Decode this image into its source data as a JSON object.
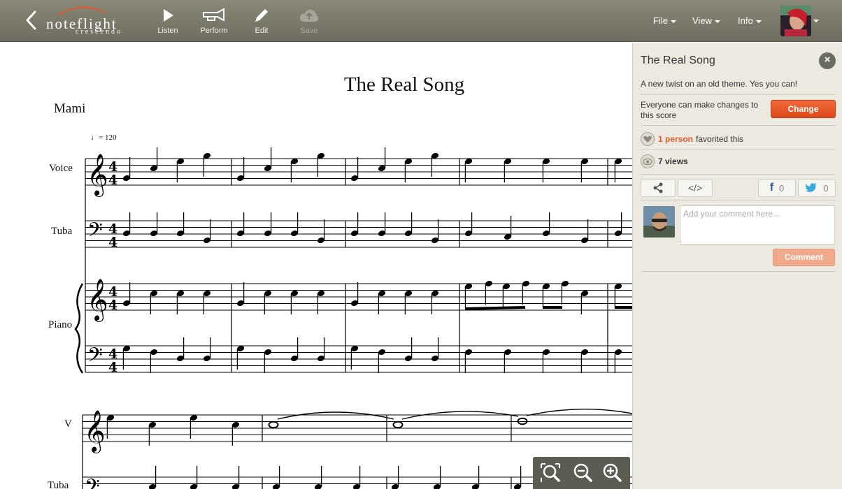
{
  "toolbar": {
    "logo_main": "noteflight",
    "logo_sub": "crescendo",
    "tools": [
      {
        "label": "Listen",
        "icon": "play-icon"
      },
      {
        "label": "Perform",
        "icon": "horn-icon"
      },
      {
        "label": "Edit",
        "icon": "pencil-icon"
      },
      {
        "label": "Save",
        "icon": "cloud-upload-icon",
        "disabled": true
      }
    ],
    "menus": [
      "File",
      "View",
      "Info"
    ]
  },
  "score": {
    "title": "The Real Song",
    "composer": "Mami",
    "tempo": "= 120",
    "system1_instruments": [
      "Voice",
      "Tuba",
      "Piano"
    ],
    "system2_instruments": [
      "V",
      "Tuba"
    ],
    "time_signature": "4/4"
  },
  "panel": {
    "title": "The Real Song",
    "description": "A new twist on an old theme. Yes you can!",
    "permission_text": "Everyone can make changes to this score",
    "change_label": "Change",
    "favorites_count": "1 person",
    "favorites_text": "favorited this",
    "views_count": "7 views",
    "share_icon": "share-icon",
    "embed_label": "</>",
    "facebook_count": "0",
    "twitter_count": "0",
    "comment_placeholder": "Add your comment here...",
    "comment_label": "Comment"
  },
  "colors": {
    "toolbar": "#7d7b6d",
    "panel": "#eceae0",
    "accent": "#e05a28",
    "facebook": "#3b5998",
    "twitter": "#33aadd"
  }
}
